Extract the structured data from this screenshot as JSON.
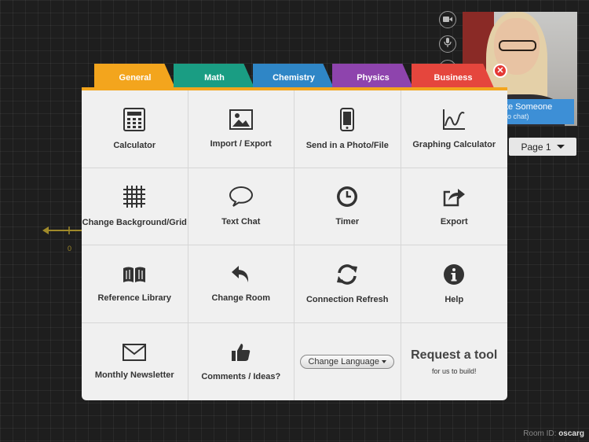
{
  "tabs": [
    {
      "label": "General",
      "color": "#f3a51d"
    },
    {
      "label": "Math",
      "color": "#1a9d83"
    },
    {
      "label": "Chemistry",
      "color": "#2f86c6"
    },
    {
      "label": "Physics",
      "color": "#8e44ad"
    },
    {
      "label": "Business",
      "color": "#e5463d"
    }
  ],
  "tools": [
    {
      "label": "Calculator",
      "icon": "calculator-icon"
    },
    {
      "label": "Import / Export",
      "icon": "image-icon"
    },
    {
      "label": "Send in a Photo/File",
      "icon": "phone-icon"
    },
    {
      "label": "Graphing Calculator",
      "icon": "graph-icon"
    },
    {
      "label": "Change Background/Grid",
      "icon": "grid-icon"
    },
    {
      "label": "Text Chat",
      "icon": "chat-bubble-icon"
    },
    {
      "label": "Timer",
      "icon": "clock-icon"
    },
    {
      "label": "Export",
      "icon": "share-export-icon"
    },
    {
      "label": "Reference Library",
      "icon": "book-icon"
    },
    {
      "label": "Change Room",
      "icon": "reply-arrow-icon"
    },
    {
      "label": "Connection Refresh",
      "icon": "refresh-icon"
    },
    {
      "label": "Help",
      "icon": "info-icon"
    },
    {
      "label": "Monthly Newsletter",
      "icon": "envelope-icon"
    },
    {
      "label": "Comments / Ideas?",
      "icon": "thumbs-up-icon"
    }
  ],
  "language_button": "Change Language",
  "request_tool": {
    "title": "Request a tool",
    "subtitle": "for us to build!"
  },
  "invite": {
    "line1": "vite Someone",
    "line2": "deo chat)"
  },
  "page_button": "Page 1",
  "axis_zero_label": "0",
  "room": {
    "label": "Room ID:",
    "value": "oscarg"
  },
  "close_symbol": "✕",
  "colors": {
    "accent": "#f3a51d",
    "panel": "#f0f0f0",
    "close": "#e53935",
    "invite": "#3d8fd6"
  }
}
